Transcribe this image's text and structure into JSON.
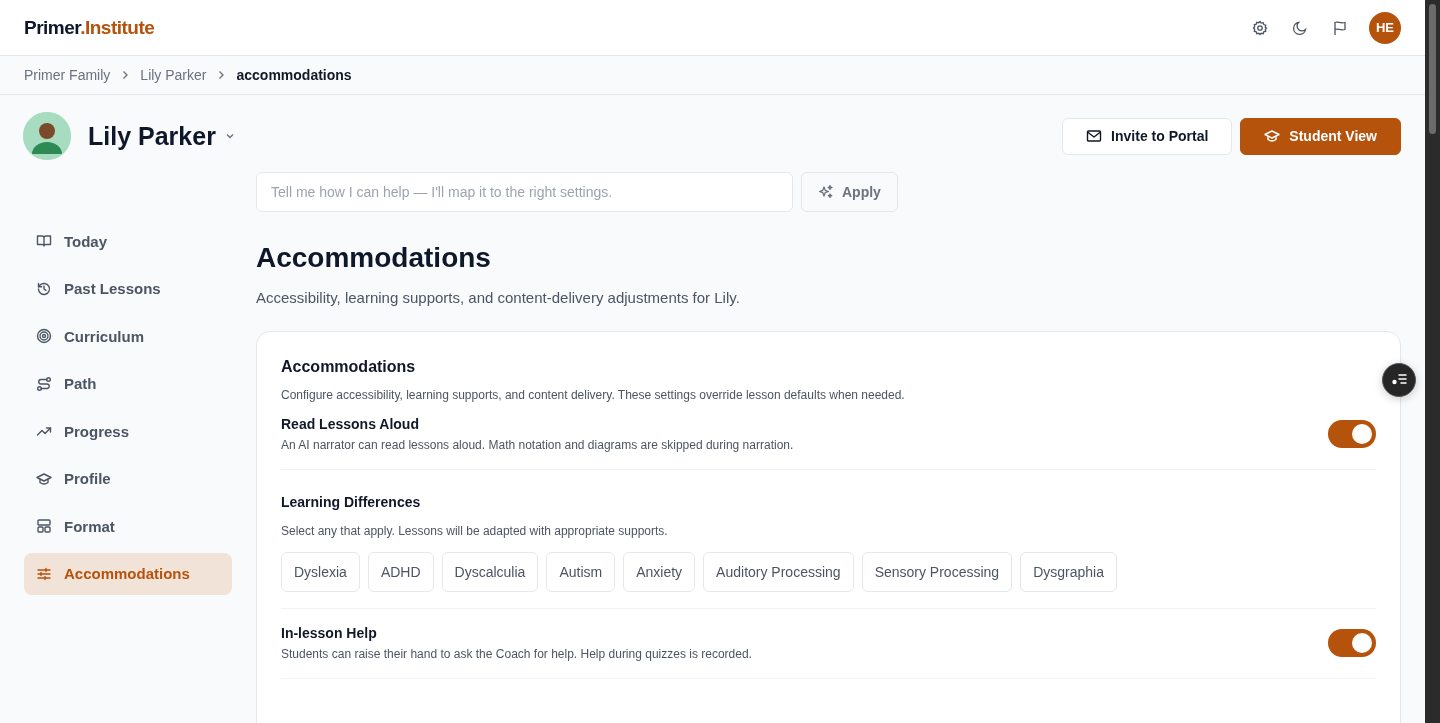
{
  "brand": {
    "name": "Primer",
    "accent": ".Institute"
  },
  "account": {
    "initials": "HE"
  },
  "breadcrumb": [
    "Primer Family",
    "Lily Parker",
    "accommodations"
  ],
  "student": {
    "name": "Lily Parker"
  },
  "buttons": [
    {
      "label": "Invite to Portal",
      "kind": "secondary"
    },
    {
      "label": "Student View",
      "kind": "primary"
    }
  ],
  "assistant": {
    "placeholder": "Tell me how I can help — I'll map it to the right settings.",
    "button": "Apply"
  },
  "sidebar": {
    "items": [
      {
        "label": "Today",
        "selected": false
      },
      {
        "label": "Past Lessons",
        "selected": false
      },
      {
        "label": "Curriculum",
        "selected": false
      },
      {
        "label": "Path",
        "selected": false
      },
      {
        "label": "Progress",
        "selected": false
      },
      {
        "label": "Profile",
        "selected": false
      },
      {
        "label": "Format",
        "selected": false
      },
      {
        "label": "Accommodations",
        "selected": true
      }
    ]
  },
  "page": {
    "title": "Accommodations",
    "subtitle": "Accessibility, learning supports, and content-delivery adjustments for Lily."
  },
  "card": {
    "title": "Accommodations",
    "description": "Configure accessibility, learning supports, and content delivery. These settings override lesson defaults when needed.",
    "sections": [
      {
        "kind": "toggle",
        "title": "Read Lessons Aloud",
        "description": "An AI narrator can read lessons aloud. Math notation and diagrams are skipped during narration.",
        "on": true
      },
      {
        "kind": "chips",
        "title": "Learning Differences",
        "description": "Select any that apply. Lessons will be adapted with appropriate supports.",
        "chips": [
          {
            "label": "Dyslexia",
            "selected": false
          },
          {
            "label": "ADHD",
            "selected": false
          },
          {
            "label": "Dyscalculia",
            "selected": false
          },
          {
            "label": "Autism",
            "selected": false
          },
          {
            "label": "Anxiety",
            "selected": false
          },
          {
            "label": "Auditory Processing",
            "selected": false
          },
          {
            "label": "Sensory Processing",
            "selected": false
          },
          {
            "label": "Dysgraphia",
            "selected": false
          }
        ]
      },
      {
        "kind": "toggle",
        "title": "In-lesson Help",
        "description": "Students can raise their hand to ask the Coach for help. Help during quizzes is recorded.",
        "on": true
      }
    ]
  }
}
